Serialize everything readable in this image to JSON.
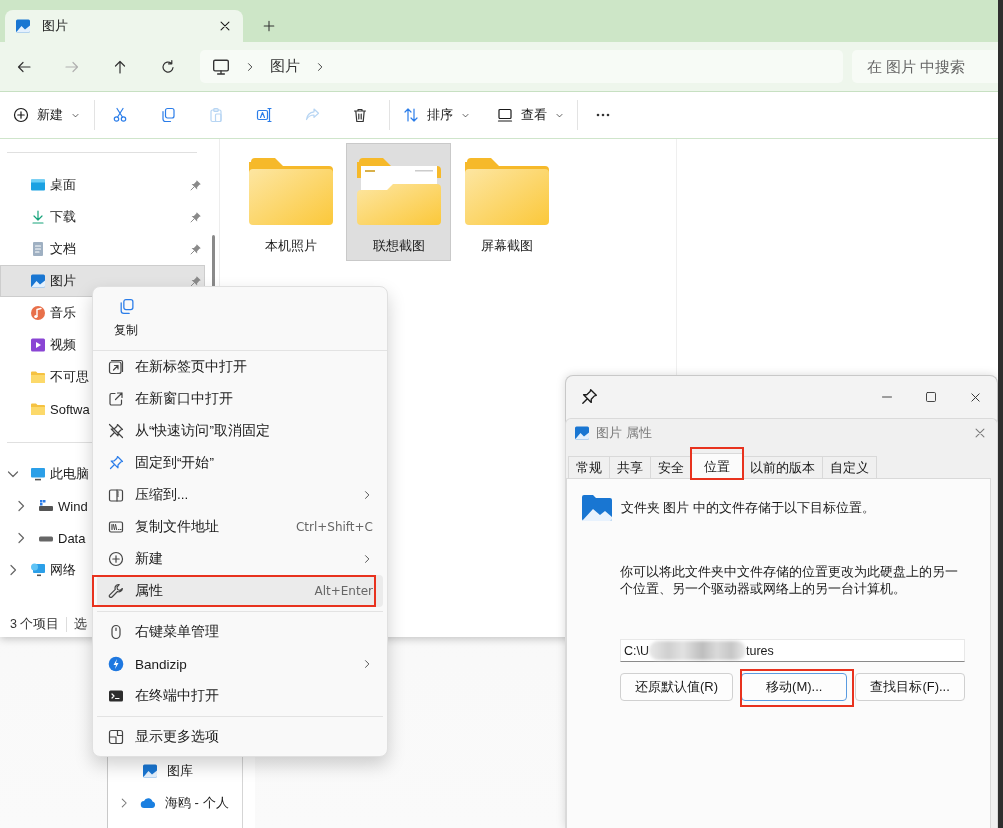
{
  "explorer": {
    "tabs": [
      {
        "label": "图片",
        "selected": true
      }
    ],
    "nav_buttons": [
      {
        "kind": "back",
        "disabled": false
      },
      {
        "kind": "forward",
        "disabled": true
      },
      {
        "kind": "up",
        "disabled": false
      },
      {
        "kind": "refresh",
        "disabled": false
      }
    ],
    "breadcrumb": [
      "图片"
    ],
    "search": {
      "placeholder": "在 图片 中搜索"
    },
    "toolbar": [
      {
        "kind": "new",
        "label": "新建",
        "disabled": false
      },
      {
        "kind": "separator"
      },
      {
        "kind": "cut",
        "disabled": false
      },
      {
        "kind": "copy",
        "disabled": false
      },
      {
        "kind": "paste",
        "disabled": true
      },
      {
        "kind": "rename",
        "disabled": false
      },
      {
        "kind": "share",
        "disabled": true
      },
      {
        "kind": "delete",
        "disabled": false
      },
      {
        "kind": "separator"
      },
      {
        "kind": "sort",
        "label": "排序",
        "disabled": false
      },
      {
        "kind": "view",
        "label": "查看",
        "disabled": false
      },
      {
        "kind": "separator"
      },
      {
        "kind": "more",
        "disabled": false
      }
    ],
    "quick_access": [
      {
        "label": "桌面",
        "kind": "desktop",
        "pinned": true,
        "selected": false
      },
      {
        "label": "下载",
        "kind": "download",
        "pinned": true,
        "selected": false
      },
      {
        "label": "文档",
        "kind": "document",
        "pinned": true,
        "selected": false
      },
      {
        "label": "图片",
        "kind": "picture",
        "pinned": true,
        "selected": true
      },
      {
        "label": "音乐",
        "kind": "music",
        "pinned": false,
        "selected": false
      },
      {
        "label": "视频",
        "kind": "video",
        "pinned": false,
        "selected": false
      },
      {
        "label": "不可思",
        "kind": "folder",
        "pinned": false,
        "selected": false
      },
      {
        "label": "Softwa",
        "kind": "folder",
        "pinned": false,
        "selected": false
      }
    ],
    "tree": [
      {
        "label": "此电脑",
        "kind": "pc",
        "expanded": true,
        "children": [
          {
            "label": "Wind",
            "kind": "system-drive",
            "expanded": false
          },
          {
            "label": "Data",
            "kind": "drive",
            "expanded": false
          }
        ]
      },
      {
        "label": "网络",
        "kind": "network",
        "expanded": false
      }
    ],
    "files": [
      {
        "name": "本机照片",
        "kind": "folder",
        "selected": false
      },
      {
        "name": "联想截图",
        "kind": "folder-preview",
        "selected": true
      },
      {
        "name": "屏幕截图",
        "kind": "folder",
        "selected": false
      }
    ],
    "status_bar": {
      "count": "3 个项目",
      "selection": "选"
    }
  },
  "context_menu": {
    "top_actions": [
      {
        "kind": "copy",
        "label": "复制"
      }
    ],
    "items": [
      {
        "kind": "open-tab",
        "label": "在新标签页中打开",
        "submenu": false,
        "hovered": false,
        "highlighted": false
      },
      {
        "kind": "open-window",
        "label": "在新窗口中打开",
        "submenu": false,
        "hovered": false,
        "highlighted": false
      },
      {
        "kind": "unpin",
        "label": "从“快速访问”取消固定",
        "submenu": false,
        "hovered": false,
        "highlighted": false
      },
      {
        "kind": "pin",
        "label": "固定到“开始”",
        "submenu": false,
        "hovered": false,
        "highlighted": false
      },
      {
        "kind": "compress",
        "label": "压缩到...",
        "submenu": true,
        "hovered": false,
        "highlighted": false
      },
      {
        "kind": "copy-path",
        "label": "复制文件地址",
        "shortcut": "Ctrl+Shift+C",
        "submenu": false,
        "hovered": false,
        "highlighted": false
      },
      {
        "kind": "new",
        "label": "新建",
        "submenu": true,
        "hovered": false,
        "highlighted": false
      },
      {
        "kind": "properties",
        "label": "属性",
        "shortcut": "Alt+Enter",
        "submenu": false,
        "hovered": true,
        "highlighted": true
      },
      {
        "kind": "divider"
      },
      {
        "kind": "menu-manager",
        "label": "右键菜单管理",
        "submenu": false,
        "hovered": false,
        "highlighted": false
      },
      {
        "kind": "bandizip",
        "label": "Bandizip",
        "submenu": true,
        "hovered": false,
        "highlighted": false
      },
      {
        "kind": "terminal",
        "label": "在终端中打开",
        "submenu": false,
        "hovered": false,
        "highlighted": false
      },
      {
        "kind": "divider"
      },
      {
        "kind": "more-options",
        "label": "显示更多选项",
        "submenu": false,
        "hovered": false,
        "highlighted": false
      }
    ]
  },
  "properties": {
    "title": "图片 属性",
    "tabs": [
      {
        "label": "常规",
        "selected": false,
        "highlighted": false
      },
      {
        "label": "共享",
        "selected": false,
        "highlighted": false
      },
      {
        "label": "安全",
        "selected": false,
        "highlighted": false
      },
      {
        "label": "位置",
        "selected": true,
        "highlighted": true
      },
      {
        "label": "以前的版本",
        "selected": false,
        "highlighted": false
      },
      {
        "label": "自定义",
        "selected": false,
        "highlighted": false
      }
    ],
    "heading": "文件夹 图片 中的文件存储于以下目标位置。",
    "description": "你可以将此文件夹中文件存储的位置更改为此硬盘上的另一个位置、另一个驱动器或网络上的另一台计算机。",
    "path": {
      "start": "C:\\U",
      "end": "tures"
    },
    "buttons": [
      {
        "label": "还原默认值(R)",
        "focused": false,
        "highlighted": false
      },
      {
        "label": "移动(M)...",
        "focused": true,
        "highlighted": true
      },
      {
        "label": "查找目标(F)...",
        "focused": false,
        "highlighted": false
      }
    ]
  },
  "background_window": {
    "items": [
      {
        "label": "图库",
        "kind": "gallery",
        "expandable": false
      },
      {
        "label": "海鸥 - 个人",
        "kind": "cloud",
        "expandable": true
      }
    ]
  }
}
